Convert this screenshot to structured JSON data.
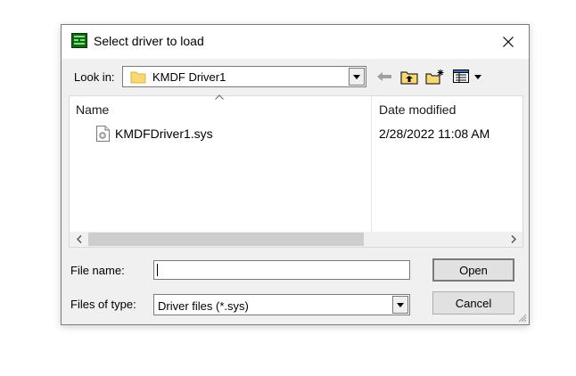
{
  "window": {
    "title": "Select driver to load"
  },
  "lookin": {
    "label": "Look in:",
    "value": "KMDF Driver1"
  },
  "list": {
    "columns": [
      "Name",
      "Date modified"
    ],
    "files": [
      {
        "name": "KMDFDriver1.sys",
        "date": "2/28/2022 11:08 AM"
      }
    ]
  },
  "filename": {
    "label": "File name:",
    "value": ""
  },
  "filetype": {
    "label": "Files of type:",
    "value": "Driver files (*.sys)"
  },
  "buttons": {
    "open": "Open",
    "cancel": "Cancel"
  },
  "colors": {
    "folder": "#f8d775",
    "app_icon": "#0d6a12",
    "scroll_thumb": "#cdcdcd"
  }
}
